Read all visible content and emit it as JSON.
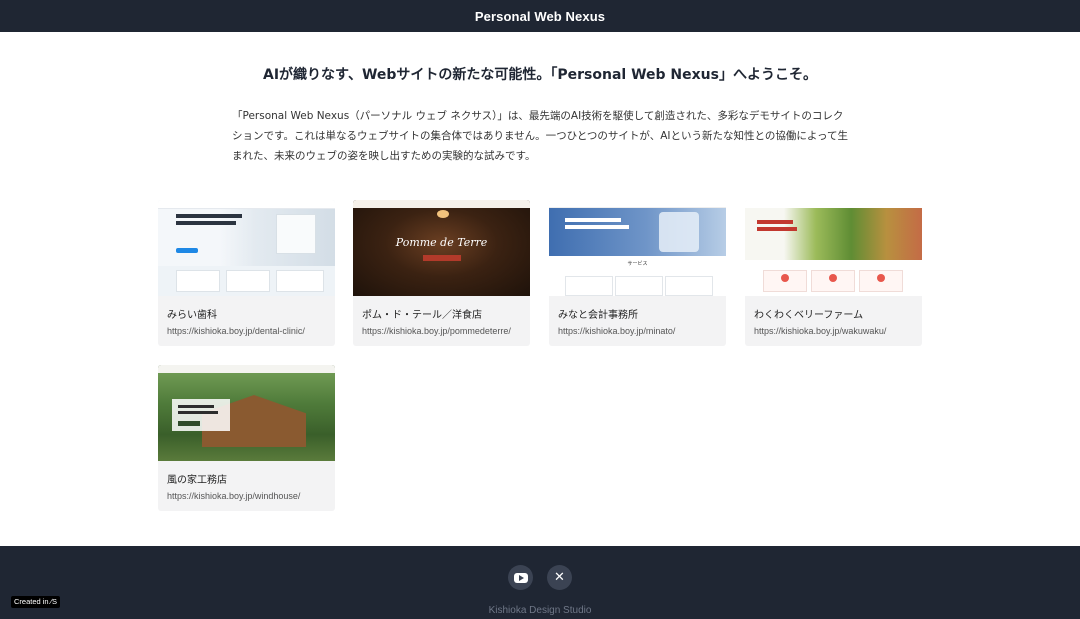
{
  "header": {
    "title": "Personal Web Nexus"
  },
  "main": {
    "headline": "AIが織りなす、Webサイトの新たな可能性。「Personal Web Nexus」へようこそ。",
    "intro": "「Personal Web Nexus（パーソナル ウェブ ネクサス）」は、最先端のAI技術を駆使して創造された、多彩なデモサイトのコレクションです。これは単なるウェブサイトの集合体ではありません。一つひとつのサイトが、AIという新たな知性との協働によって生まれた、未来のウェブの姿を映し出すための実験的な試みです。",
    "sites": [
      {
        "name": "みらい歯科",
        "url": "https://kishioka.boy.jp/dental-clinic/"
      },
      {
        "name": "ポム・ド・テール／洋食店",
        "url": "https://kishioka.boy.jp/pommedeterre/",
        "thumb_logo": "Pomme de Terre"
      },
      {
        "name": "みなと会計事務所",
        "url": "https://kishioka.boy.jp/minato/",
        "thumb_section": "サービス"
      },
      {
        "name": "わくわくベリーファーム",
        "url": "https://kishioka.boy.jp/wakuwaku/"
      },
      {
        "name": "風の家工務店",
        "url": "https://kishioka.boy.jp/windhouse/"
      }
    ]
  },
  "footer": {
    "icons": [
      "youtube-icon",
      "x-icon"
    ],
    "studio": "Kishioka Design Studio",
    "badge": "Created in ∕S"
  }
}
